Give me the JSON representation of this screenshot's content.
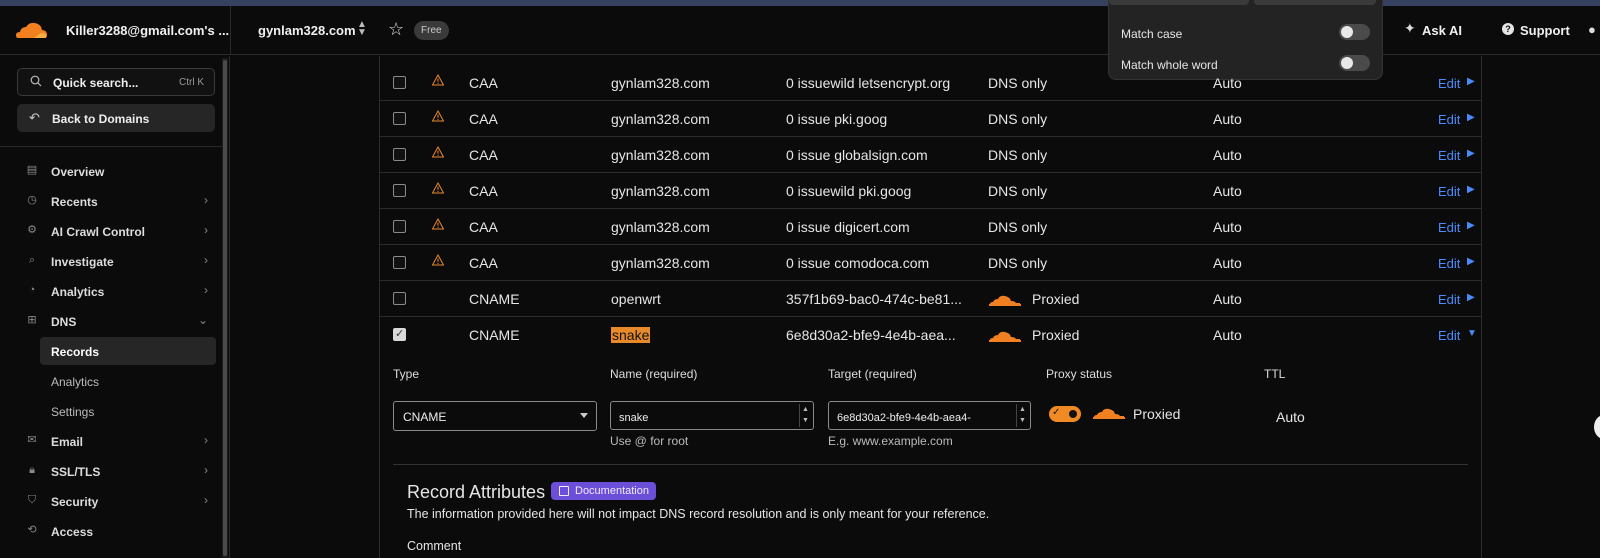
{
  "header": {
    "account": "Killer3288@gmail.com's ...",
    "domain": "gynlam328.com",
    "plan_badge": "Free",
    "ask_ai": "Ask AI",
    "support": "Support"
  },
  "find_popup": {
    "options": [
      {
        "label": "Match case",
        "enabled": false
      },
      {
        "label": "Match whole word",
        "enabled": false
      }
    ]
  },
  "sidebar": {
    "search_placeholder": "Quick search...",
    "search_shortcut": "Ctrl K",
    "back_label": "Back to Domains",
    "items": [
      {
        "label": "Overview",
        "icon": "document-icon",
        "has_chevron": false
      },
      {
        "label": "Recents",
        "icon": "clock-icon",
        "has_chevron": true
      },
      {
        "label": "AI Crawl Control",
        "icon": "robot-icon",
        "has_chevron": true
      },
      {
        "label": "Investigate",
        "icon": "magnifier-icon",
        "has_chevron": true
      },
      {
        "label": "Analytics",
        "icon": "pie-chart-icon",
        "has_chevron": true
      },
      {
        "label": "DNS",
        "icon": "network-icon",
        "has_chevron": true,
        "expanded": true
      },
      {
        "label": "Email",
        "icon": "mail-icon",
        "has_chevron": true
      },
      {
        "label": "SSL/TLS",
        "icon": "lock-icon",
        "has_chevron": true
      },
      {
        "label": "Security",
        "icon": "shield-icon",
        "has_chevron": true
      },
      {
        "label": "Access",
        "icon": "access-icon",
        "has_chevron": false
      }
    ],
    "dns_subitems": [
      {
        "label": "Records",
        "active": true
      },
      {
        "label": "Analytics",
        "active": false
      },
      {
        "label": "Settings",
        "active": false
      }
    ]
  },
  "records": [
    {
      "type": "CAA",
      "name": "gynlam328.com",
      "content": "0 issuewild letsencrypt.org",
      "proxy": "DNS only",
      "ttl": "Auto",
      "edit": "Edit",
      "warning": true,
      "checked": false
    },
    {
      "type": "CAA",
      "name": "gynlam328.com",
      "content": "0 issue pki.goog",
      "proxy": "DNS only",
      "ttl": "Auto",
      "edit": "Edit",
      "warning": true,
      "checked": false
    },
    {
      "type": "CAA",
      "name": "gynlam328.com",
      "content": "0 issue globalsign.com",
      "proxy": "DNS only",
      "ttl": "Auto",
      "edit": "Edit",
      "warning": true,
      "checked": false
    },
    {
      "type": "CAA",
      "name": "gynlam328.com",
      "content": "0 issuewild pki.goog",
      "proxy": "DNS only",
      "ttl": "Auto",
      "edit": "Edit",
      "warning": true,
      "checked": false
    },
    {
      "type": "CAA",
      "name": "gynlam328.com",
      "content": "0 issue digicert.com",
      "proxy": "DNS only",
      "ttl": "Auto",
      "edit": "Edit",
      "warning": true,
      "checked": false
    },
    {
      "type": "CAA",
      "name": "gynlam328.com",
      "content": "0 issue comodoca.com",
      "proxy": "DNS only",
      "ttl": "Auto",
      "edit": "Edit",
      "warning": true,
      "checked": false
    },
    {
      "type": "CNAME",
      "name": "openwrt",
      "content": "357f1b69-bac0-474c-be81...",
      "proxy": "Proxied",
      "ttl": "Auto",
      "edit": "Edit",
      "warning": false,
      "checked": false
    },
    {
      "type": "CNAME",
      "name": "snake",
      "content": "6e8d30a2-bfe9-4e4b-aea...",
      "proxy": "Proxied",
      "ttl": "Auto",
      "edit": "Edit",
      "warning": false,
      "checked": true
    }
  ],
  "edit_form": {
    "type_label": "Type",
    "type_value": "CNAME",
    "name_label": "Name (required)",
    "name_value": "snake",
    "name_hint": "Use @ for root",
    "target_label": "Target (required)",
    "target_value": "6e8d30a2-bfe9-4e4b-aea4-",
    "target_hint": "E.g. www.example.com",
    "proxy_label": "Proxy status",
    "proxy_value": "Proxied",
    "ttl_label": "TTL",
    "ttl_value": "Auto"
  },
  "record_attributes": {
    "title": "Record Attributes",
    "doc_badge": "Documentation",
    "description": "The information provided here will not impact DNS record resolution and is only meant for your reference.",
    "comment_label": "Comment"
  },
  "colors": {
    "accent_orange": "#f08a24",
    "link_blue": "#4a8cff",
    "doc_purple": "#6b4fd9",
    "warning_orange": "#e8892c"
  }
}
